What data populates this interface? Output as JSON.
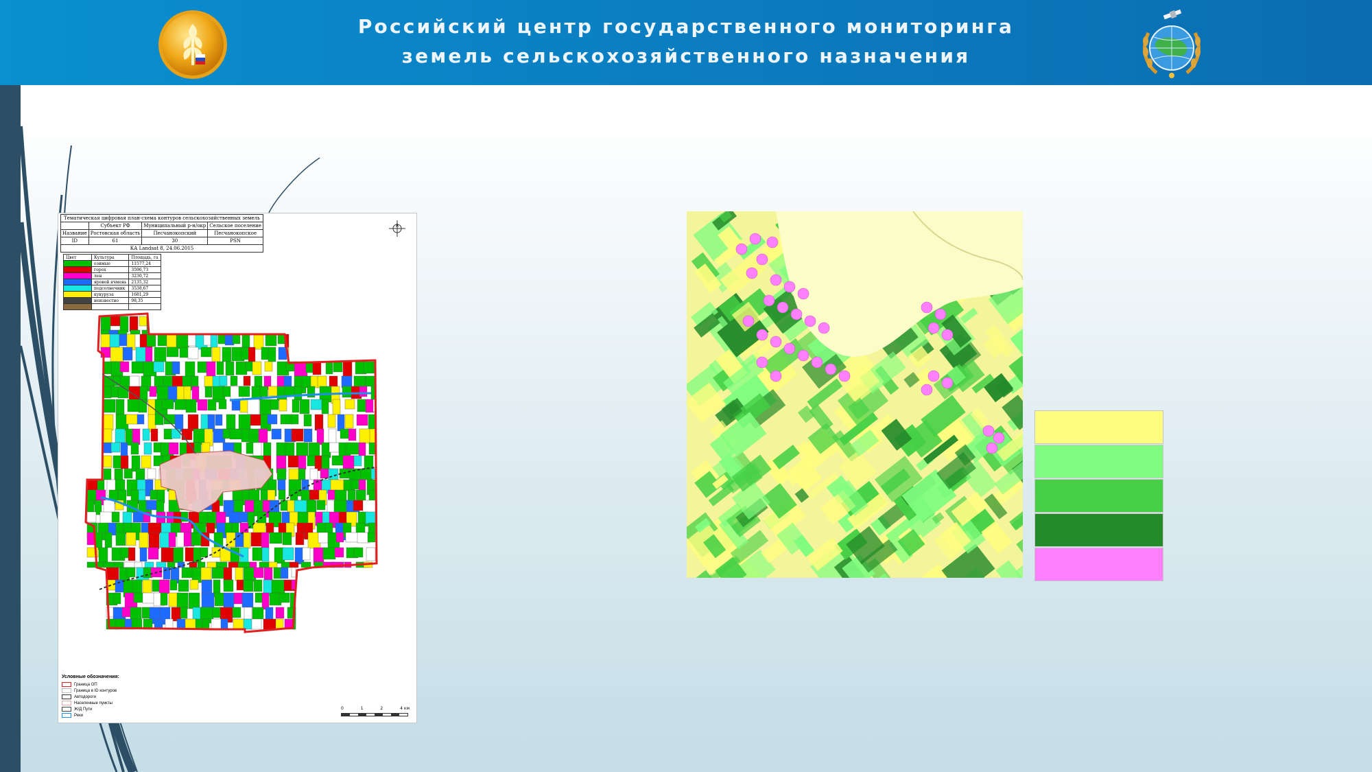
{
  "header": {
    "title_line1": "Российский центр государственного мониторинга",
    "title_line2": "земель сельскохозяйственного назначения",
    "colors": {
      "bar": "#0b7fc2",
      "title": "#eef6fb"
    }
  },
  "icons": {
    "left_logo": "wheat-emblem-icon",
    "right_logo": "globe-satellite-emblem-icon"
  },
  "map": {
    "title": "Тематическая цифровая план-схема контуров сельскохозяйственных земель",
    "table": {
      "row1": [
        "",
        "Субъект РФ",
        "Муниципальный р-н/окр",
        "Сельское поселение"
      ],
      "row2": [
        "Название",
        "Ростовская область",
        "Песчанокопский",
        "Песчанокопское"
      ],
      "row3": [
        "ID",
        "61",
        "30",
        "PSN"
      ],
      "row4": "КА Landsat 8, 24.06.2015"
    },
    "crops": {
      "headers": [
        "Цвет",
        "Культура",
        "Площадь, га"
      ],
      "rows": [
        {
          "name": "озимые",
          "area": "11577,24",
          "color": "#00c000"
        },
        {
          "name": "горох",
          "area": "3596,73",
          "color": "#e00000"
        },
        {
          "name": "лен",
          "area": "3230,72",
          "color": "#ff00c8"
        },
        {
          "name": "яровой ячмень",
          "area": "2135,32",
          "color": "#1e6bff"
        },
        {
          "name": "подсолнечник",
          "area": "3538,67",
          "color": "#18e6e0"
        },
        {
          "name": "кукуруза",
          "area": "1681,29",
          "color": "#fff000"
        },
        {
          "name": "неизвестно",
          "area": "98,35",
          "color": "#444444"
        },
        {
          "name": "",
          "area": "",
          "color": "#8b6a3c"
        }
      ]
    },
    "legend_title": "Условные обозначения:",
    "legend_items": [
      {
        "label": "Граница ОП",
        "color": "#e02020"
      },
      {
        "label": "Граница в ID контуров",
        "color": "#bbbbbb"
      },
      {
        "label": "Автодороги",
        "color": "#333333"
      },
      {
        "label": "Населенные пункты",
        "color": "#e8a6a6"
      },
      {
        "label": "Ж/Д Пути",
        "color": "#444444"
      },
      {
        "label": "Реки",
        "color": "#1f8ee8"
      }
    ],
    "scale": [
      "0",
      "1",
      "2",
      "4 км"
    ]
  },
  "satellite_legend": {
    "swatches": [
      "#fdfd80",
      "#80fd80",
      "#45d045",
      "#248a2a",
      "#ff80ff"
    ]
  }
}
